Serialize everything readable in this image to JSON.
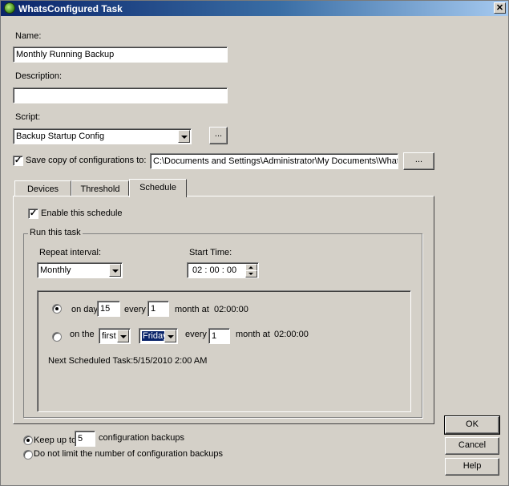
{
  "window": {
    "title": "WhatsConfigured Task",
    "close_glyph": "✕"
  },
  "form": {
    "name_label": "Name:",
    "name_value": "Monthly Running Backup",
    "description_label": "Description:",
    "description_value": "",
    "script_label": "Script:",
    "script_value": "Backup Startup Config",
    "browse_label": "...",
    "save_copy_label": "Save copy of configurations to:",
    "save_copy_checked": true,
    "save_path_value": "C:\\Documents and Settings\\Administrator\\My Documents\\WhatsConn",
    "save_path_browse_label": "..."
  },
  "tabs": [
    {
      "label": "Devices"
    },
    {
      "label": "Threshold"
    },
    {
      "label": "Schedule"
    }
  ],
  "schedule": {
    "enable_label": "Enable this schedule",
    "enable_checked": true,
    "run_task_title": "Run this task",
    "repeat_label": "Repeat interval:",
    "repeat_value": "Monthly",
    "start_time_label": "Start Time:",
    "start_hh": "02",
    "start_mm": "00",
    "start_ss": "00",
    "sep": ":",
    "option1": {
      "on_day_label": "on day",
      "day_value": "15",
      "every_label": "every",
      "every_value": "1",
      "month_at_label": "month at",
      "time": "02:00:00"
    },
    "option2": {
      "on_the_label": "on the",
      "ordinal_value": "first",
      "weekday_value": "Friday",
      "every_label": "every",
      "every_value": "1",
      "month_at_label": "month at",
      "time": "02:00:00"
    },
    "next_label": "Next Scheduled Task:",
    "next_value": "5/15/2010 2:00 AM"
  },
  "retention": {
    "keep_label": "Keep up to",
    "keep_value": "5",
    "keep_suffix": "configuration backups",
    "no_limit_label": "Do not limit the number of configuration backups"
  },
  "buttons": {
    "ok": "OK",
    "cancel": "Cancel",
    "help": "Help"
  }
}
